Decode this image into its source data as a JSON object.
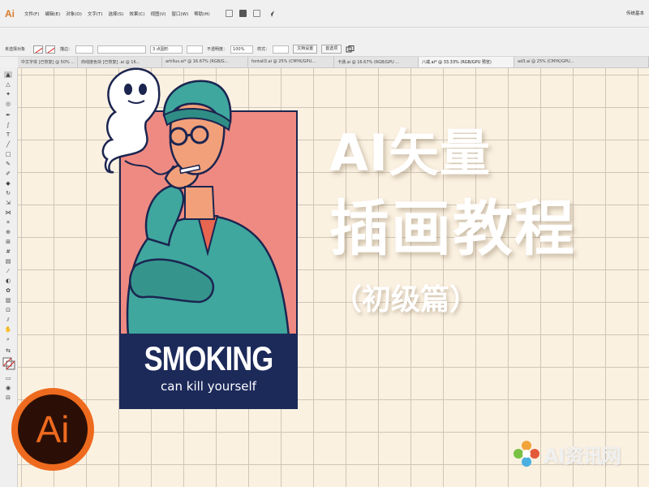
{
  "app": {
    "logo": "Ai",
    "workspace": "传统基本"
  },
  "menu": [
    "文件(F)",
    "编辑(E)",
    "对象(O)",
    "文字(T)",
    "选择(S)",
    "效果(C)",
    "视图(V)",
    "窗口(W)",
    "帮助(H)"
  ],
  "control_bar": {
    "selection": "未选择对象",
    "stroke_label": "描边：",
    "stroke_weight": "3 点圆形",
    "opacity_label": "不透明度：",
    "opacity": "100%",
    "style_label": "样式：",
    "doc_setup": "文档设置",
    "preferences": "首选项"
  },
  "tabs": [
    {
      "label": "中文字体 [已恢复] @ 50% ...",
      "active": false
    },
    {
      "label": "商线度色块 [已恢复] .ai @ 16...",
      "active": false
    },
    {
      "label": "artillus.ai* @ 16.67% (RGB/G...",
      "active": false
    },
    {
      "label": "fontall3.ai @ 25% (CMYK/GPU...",
      "active": false
    },
    {
      "label": "卡通.ai @ 16.67% (RGB/GPU ...",
      "active": false
    },
    {
      "label": "八戒.ai* @ 33.33% (RGB/GPU 预览)",
      "active": true
    },
    {
      "label": "ad3.ai @ 25% (CMYK/GPU...",
      "active": false
    }
  ],
  "artwork": {
    "headline": "SMOKING",
    "tagline": "can kill yourself",
    "colors": {
      "card": "#ef8a82",
      "banner": "#1c2a5a",
      "teal": "#3fa79e",
      "skin": "#f2a07a"
    }
  },
  "title": {
    "line1": "AI矢量",
    "line2": "插画教程",
    "subtitle": "（初级篇）"
  },
  "badge": {
    "text": "Ai",
    "ring_color": "#ee6a1e",
    "inner_color": "#2b0f06"
  },
  "watermark": {
    "text": "AI资讯网"
  }
}
